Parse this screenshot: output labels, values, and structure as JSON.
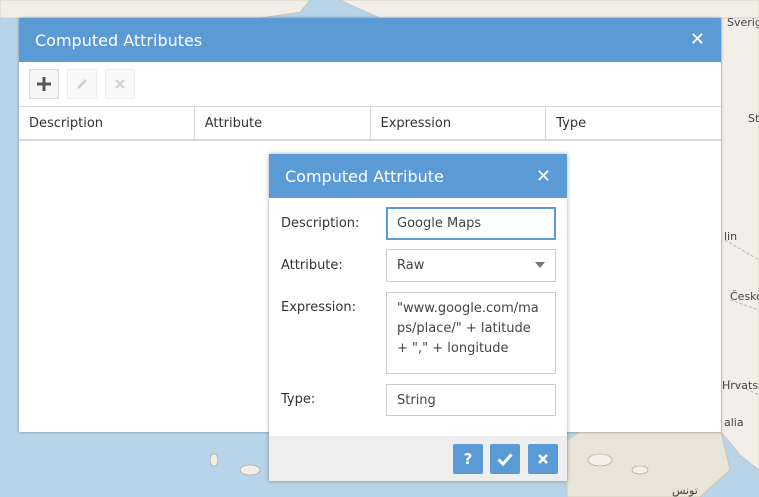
{
  "map": {
    "labels": [
      "Sverig",
      "St",
      "lin",
      "Česko",
      "Hrvatsk",
      "alia",
      "تونس"
    ]
  },
  "outer_window": {
    "title": "Computed Attributes",
    "close_glyph": "✕",
    "toolbar": {
      "add_icon": "plus-icon",
      "edit_icon": "pencil-icon",
      "delete_icon": "cross-icon"
    },
    "columns": [
      "Description",
      "Attribute",
      "Expression",
      "Type"
    ]
  },
  "dialog": {
    "title": "Computed Attribute",
    "close_glyph": "✕",
    "description_label": "Description:",
    "description_value": "Google Maps",
    "attribute_label": "Attribute:",
    "attribute_value": "Raw",
    "expression_label": "Expression:",
    "expression_value": "\"www.google.com/maps/place/\" + latitude + \",\" + longitude",
    "type_label": "Type:",
    "type_value": "String",
    "buttons": {
      "help": "?",
      "confirm_icon": "check-icon",
      "cancel_icon": "close-icon"
    }
  },
  "colors": {
    "accent": "#5b9bd5",
    "map_water": "#b8d4e8",
    "map_land": "#f2efe9"
  }
}
